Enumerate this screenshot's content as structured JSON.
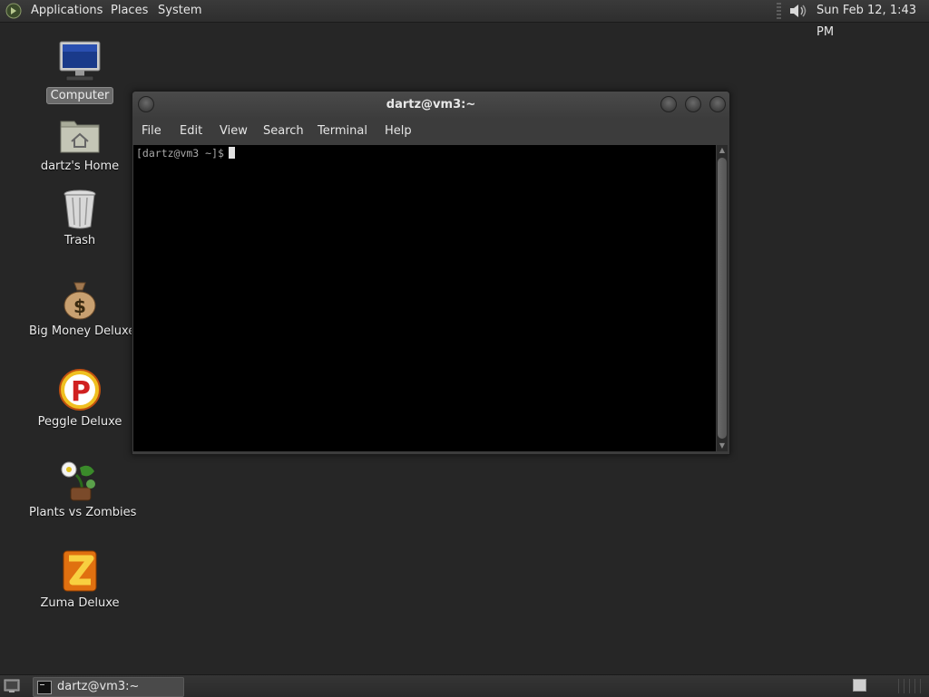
{
  "top_panel": {
    "menus": [
      "Applications",
      "Places",
      "System"
    ],
    "clock": "Sun Feb 12,  1:43 PM",
    "icons": [
      "foot-logo-icon",
      "volume-icon"
    ]
  },
  "desktop_icons": [
    {
      "label": "Computer",
      "icon": "computer-icon",
      "selected": true
    },
    {
      "label": "dartz's Home",
      "icon": "home-folder-icon"
    },
    {
      "label": "Trash",
      "icon": "trash-icon"
    },
    {
      "label": "Big Money Deluxe",
      "icon": "money-bag-icon"
    },
    {
      "label": "Peggle Deluxe",
      "icon": "peggle-icon"
    },
    {
      "label": "Plants vs Zombies",
      "icon": "plants-vs-zombies-icon"
    },
    {
      "label": "Zuma Deluxe",
      "icon": "zuma-icon"
    }
  ],
  "terminal": {
    "title": "dartz@vm3:~",
    "menu": [
      "File",
      "Edit",
      "View",
      "Search",
      "Terminal",
      "Help"
    ],
    "prompt": "[dartz@vm3 ~]$"
  },
  "bottom_panel": {
    "task": "dartz@vm3:~"
  },
  "colors": {
    "desktop_bg": "#262626",
    "panel_bg": "#333333",
    "terminal_bg": "#000000"
  }
}
